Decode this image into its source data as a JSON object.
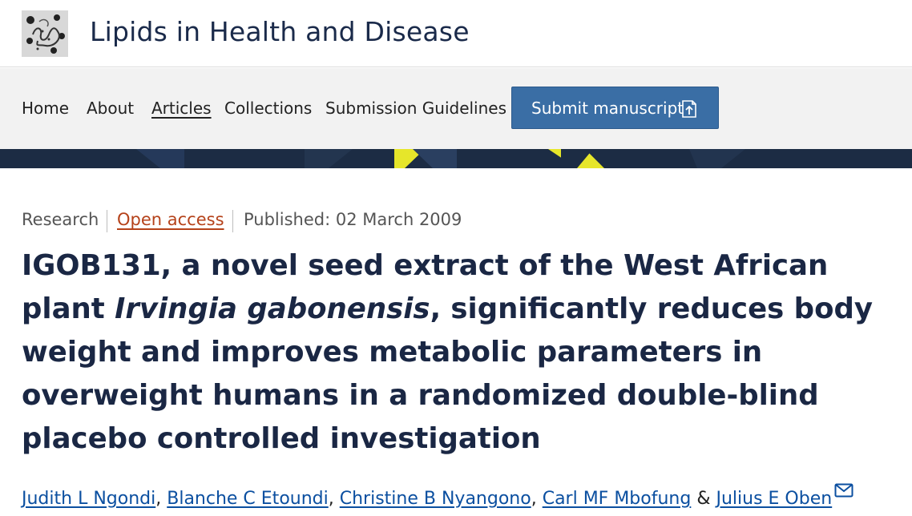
{
  "header": {
    "journal_title": "Lipids in Health and Disease",
    "logo_icon": "journal-logo-icon"
  },
  "nav": {
    "items": [
      {
        "label": "Home",
        "active": false
      },
      {
        "label": "About",
        "active": false
      },
      {
        "label": "Articles",
        "active": true
      },
      {
        "label": "Collections",
        "active": false
      },
      {
        "label": "Submission Guidelines",
        "active": false
      }
    ],
    "submit_label": "Submit manuscript",
    "submit_icon": "external-submit-icon"
  },
  "article": {
    "type": "Research",
    "access": "Open access",
    "published": "Published: 02 March 2009",
    "title_part1": "IGOB131, a novel seed extract of the West African plant ",
    "title_italic": "Irvingia gabonensis",
    "title_part2": ", significantly reduces body weight and improves metabolic parameters in overweight humans in a randomized double-blind placebo controlled investigation",
    "authors": [
      "Judith L Ngondi",
      "Blanche C Etoundi",
      "Christine B Nyangono",
      "Carl MF Mbofung",
      "Julius E Oben"
    ],
    "author_separator": ", ",
    "author_last_separator": " & ",
    "corresponding_icon": "envelope-icon"
  },
  "colors": {
    "brand_navy": "#1c2c44",
    "button_blue": "#3a6ea5",
    "open_access_orange": "#b5421a",
    "link_blue": "#0b4fa0",
    "accent_yellow": "#e6e62a"
  }
}
